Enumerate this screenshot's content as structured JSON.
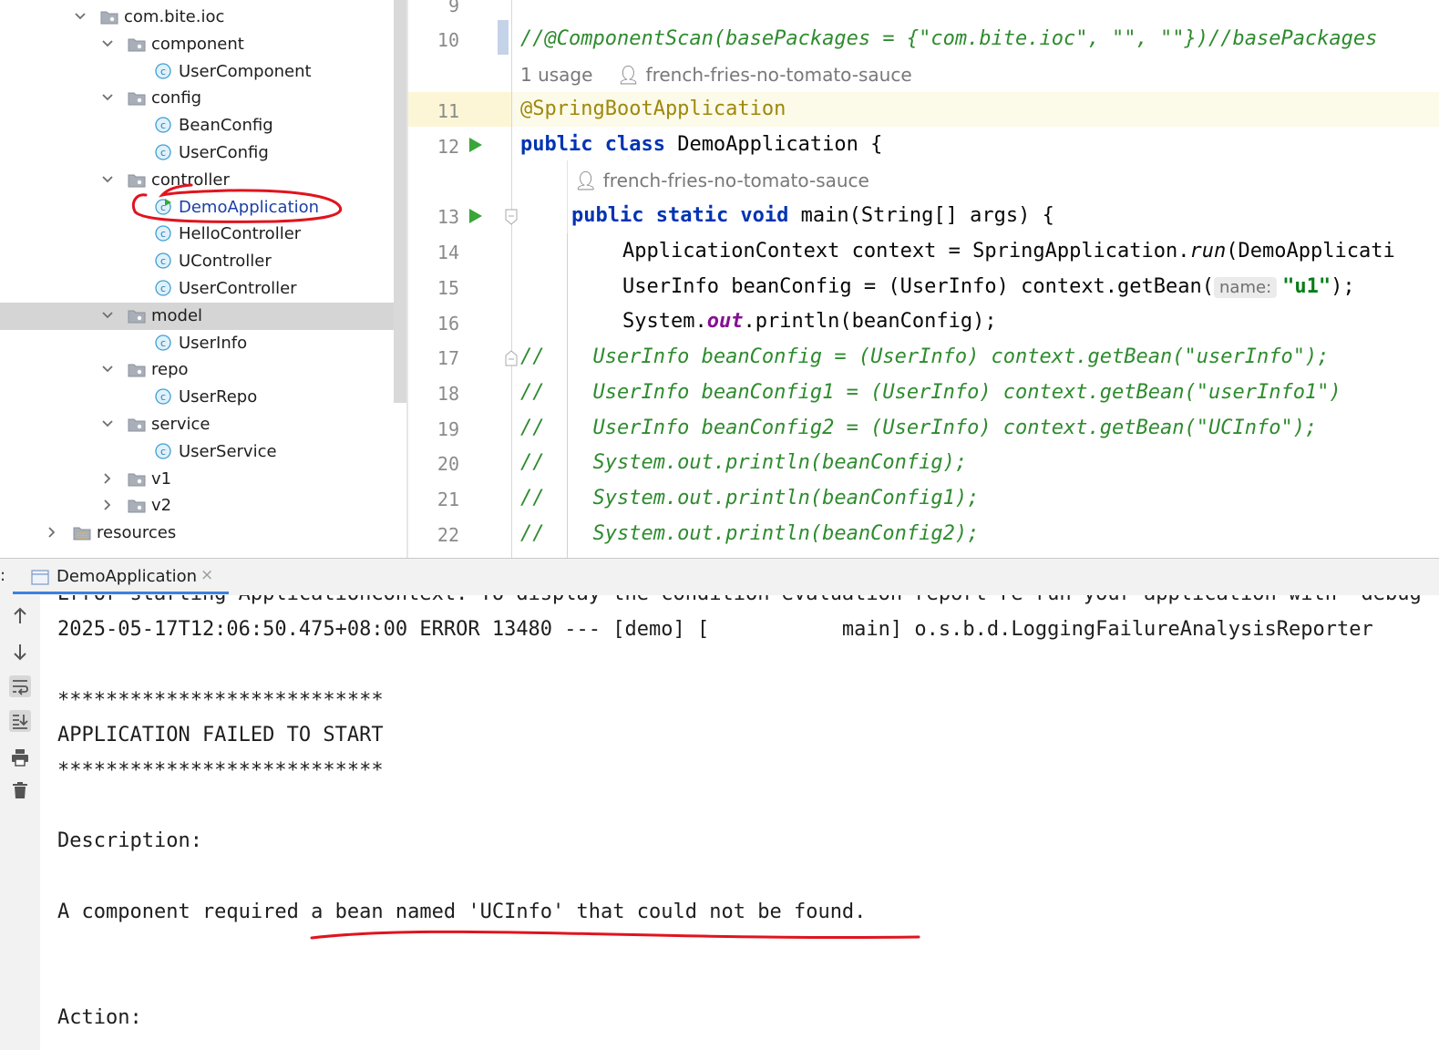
{
  "project_tree": {
    "items": [
      {
        "label": "com.bite.ioc",
        "kind": "folder",
        "expanded": true
      },
      {
        "label": "component",
        "kind": "folder",
        "expanded": true
      },
      {
        "label": "UserComponent",
        "kind": "class"
      },
      {
        "label": "config",
        "kind": "folder",
        "expanded": true
      },
      {
        "label": "BeanConfig",
        "kind": "class"
      },
      {
        "label": "UserConfig",
        "kind": "class"
      },
      {
        "label": "controller",
        "kind": "folder",
        "expanded": true
      },
      {
        "label": "DemoApplication",
        "kind": "class",
        "runnable": true,
        "annotated": true
      },
      {
        "label": "HelloController",
        "kind": "class"
      },
      {
        "label": "UController",
        "kind": "class"
      },
      {
        "label": "UserController",
        "kind": "class"
      },
      {
        "label": "model",
        "kind": "folder",
        "expanded": true,
        "selected": true
      },
      {
        "label": "UserInfo",
        "kind": "class"
      },
      {
        "label": "repo",
        "kind": "folder",
        "expanded": true
      },
      {
        "label": "UserRepo",
        "kind": "class"
      },
      {
        "label": "service",
        "kind": "folder",
        "expanded": true
      },
      {
        "label": "UserService",
        "kind": "class"
      },
      {
        "label": "v1",
        "kind": "folder",
        "expanded": false
      },
      {
        "label": "v2",
        "kind": "folder",
        "expanded": false
      },
      {
        "label": "resources",
        "kind": "resources-folder",
        "expanded": false
      }
    ]
  },
  "editor": {
    "line_numbers": {
      "l9": "9",
      "l10": "10",
      "l11": "11",
      "l12": "12",
      "l13": "13",
      "l14": "14",
      "l15": "15",
      "l16": "16",
      "l17": "17",
      "l18": "18",
      "l19": "19",
      "l20": "20",
      "l21": "21",
      "l22": "22"
    },
    "line10": "//@ComponentScan(basePackages = {\"com.bite.ioc\", \"\", \"\"})//basePackages",
    "usage_hint": "1 usage",
    "author_hint_1": "french-fries-no-tomato-sauce",
    "author_hint_2": "french-fries-no-tomato-sauce",
    "line11": "@SpringBootApplication",
    "line12": {
      "kw": "public class",
      "rest": " DemoApplication {"
    },
    "line13": {
      "kw": "public static void",
      "rest": " main(String[] args) {"
    },
    "line14": {
      "pre": "ApplicationContext context = SpringApplication.",
      "method": "run",
      "post": "(DemoApplicati"
    },
    "line15": {
      "pre": "UserInfo beanConfig = (UserInfo) context.getBean(",
      "hint": "name:",
      "str": "\"u1\"",
      "post": ");"
    },
    "line16": {
      "pre": "System.",
      "field": "out",
      "post": ".println(beanConfig);"
    },
    "line17": "//    UserInfo beanConfig = (UserInfo) context.getBean(\"userInfo\");",
    "line18": "//    UserInfo beanConfig1 = (UserInfo) context.getBean(\"userInfo1\")",
    "line19": "//    UserInfo beanConfig2 = (UserInfo) context.getBean(\"UCInfo\");",
    "line20": "//    System.out.println(beanConfig);",
    "line21": "//    System.out.println(beanConfig1);",
    "line22": "//    System.out.println(beanConfig2);"
  },
  "run": {
    "colon": ":",
    "tab_label": "DemoApplication",
    "tab_close": "×",
    "console_lines": {
      "l0": "Error starting ApplicationContext. To display the condition evaluation report re-run your application with 'debug' enabled.",
      "l1": "2025-05-17T12:06:50.475+08:00 ERROR 13480 --- [demo] [           main] o.s.b.d.LoggingFailureAnalysisReporter",
      "l2": "***************************",
      "l3": "APPLICATION FAILED TO START",
      "l4": "***************************",
      "l5": "Description:",
      "l6": "A component required a bean named 'UCInfo' that could not be found.",
      "l7": "Action:"
    }
  },
  "colors": {
    "comment": "#2e8b2e",
    "keyword": "#0033b3",
    "annotation": "#9e880d",
    "string": "#067d17",
    "red_annotation": "#e0141e"
  }
}
